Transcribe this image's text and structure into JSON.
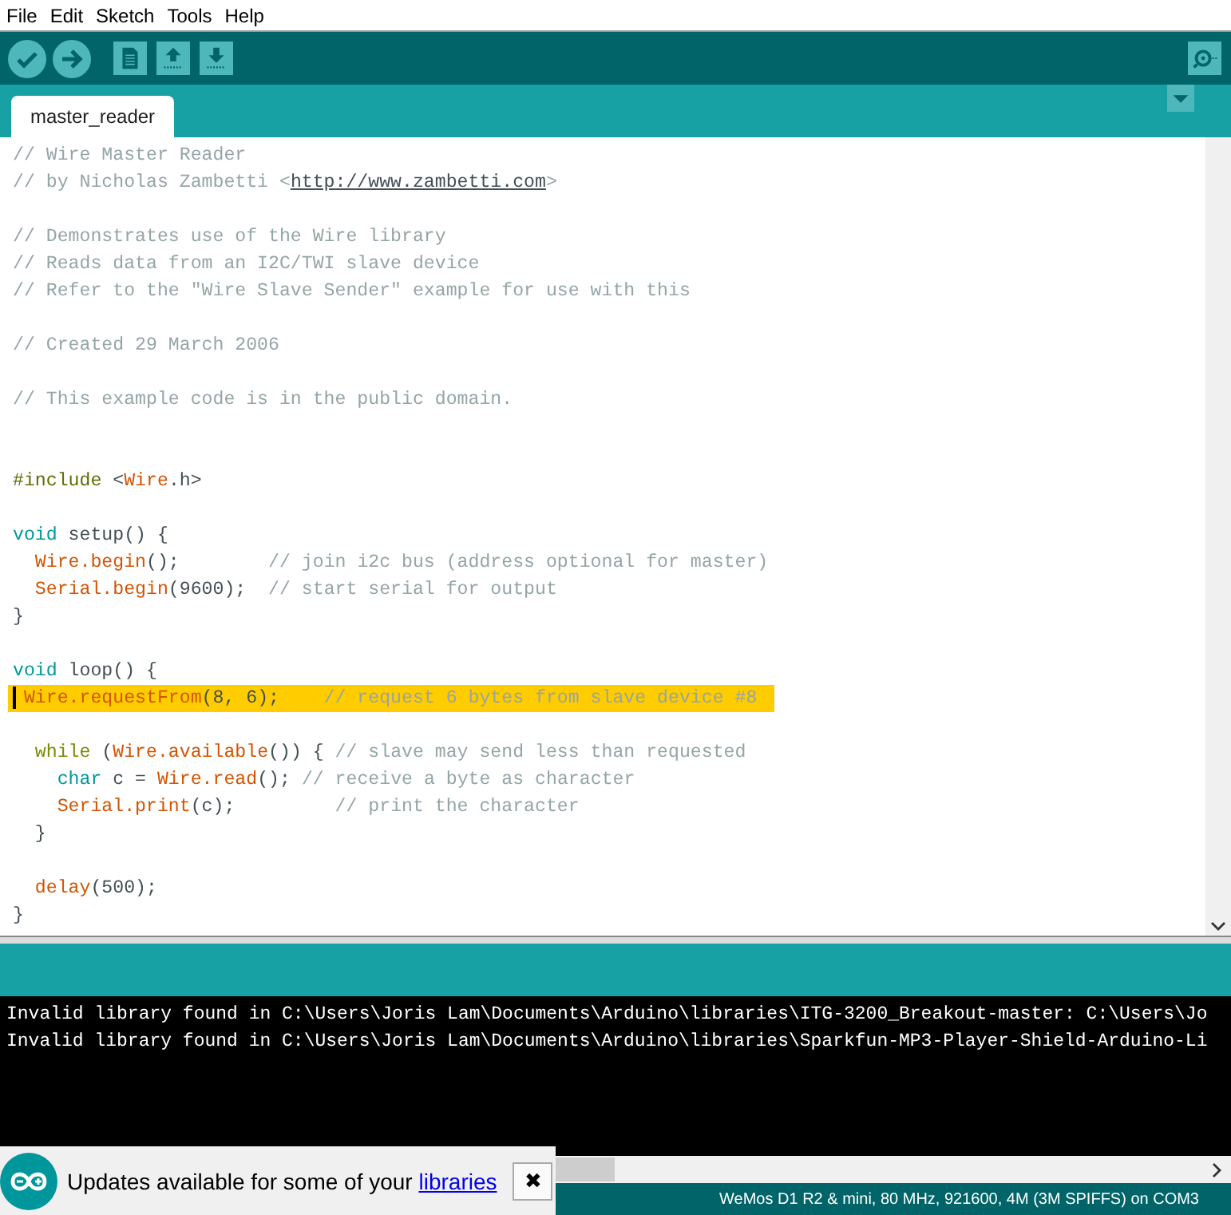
{
  "menu": [
    "File",
    "Edit",
    "Sketch",
    "Tools",
    "Help"
  ],
  "tabs": [
    {
      "label": "master_reader",
      "selected": true
    }
  ],
  "code": [
    {
      "kind": "code",
      "tokens": [
        {
          "t": "// Wire Master Reader",
          "kind": "comment"
        }
      ]
    },
    {
      "kind": "code",
      "tokens": [
        {
          "t": "// by Nicholas Zambetti <",
          "kind": "comment"
        },
        {
          "t": "http://www.zambetti.com",
          "kind": "link"
        },
        {
          "t": ">",
          "kind": "comment"
        }
      ]
    },
    {
      "kind": "blank"
    },
    {
      "kind": "code",
      "tokens": [
        {
          "t": "// Demonstrates use of the Wire library",
          "kind": "comment"
        }
      ]
    },
    {
      "kind": "code",
      "tokens": [
        {
          "t": "// Reads data from an I2C/TWI slave device",
          "kind": "comment"
        }
      ]
    },
    {
      "kind": "code",
      "tokens": [
        {
          "t": "// Refer to the \"Wire Slave Sender\" example for use with this",
          "kind": "comment"
        }
      ]
    },
    {
      "kind": "blank"
    },
    {
      "kind": "code",
      "tokens": [
        {
          "t": "// Created 29 March 2006",
          "kind": "comment"
        }
      ]
    },
    {
      "kind": "blank"
    },
    {
      "kind": "code",
      "tokens": [
        {
          "t": "// This example code is in the public domain.",
          "kind": "comment"
        }
      ]
    },
    {
      "kind": "blank"
    },
    {
      "kind": "blank"
    },
    {
      "kind": "code",
      "tokens": [
        {
          "t": "#include",
          "kind": "preproc"
        },
        {
          "t": " <",
          "kind": "plain"
        },
        {
          "t": "Wire",
          "kind": "func"
        },
        {
          "t": ".h>",
          "kind": "plain"
        }
      ]
    },
    {
      "kind": "blank"
    },
    {
      "kind": "code",
      "tokens": [
        {
          "t": "void",
          "kind": "type"
        },
        {
          "t": " setup() {",
          "kind": "plain"
        }
      ]
    },
    {
      "kind": "code",
      "tokens": [
        {
          "t": "  Wire.begin",
          "kind": "func"
        },
        {
          "t": "();        ",
          "kind": "plain"
        },
        {
          "t": "// join i2c bus (address optional for master)",
          "kind": "comment"
        }
      ]
    },
    {
      "kind": "code",
      "tokens": [
        {
          "t": "  Serial.begin",
          "kind": "func"
        },
        {
          "t": "(9600);  ",
          "kind": "plain"
        },
        {
          "t": "// start serial for output",
          "kind": "comment"
        }
      ]
    },
    {
      "kind": "code",
      "tokens": [
        {
          "t": "}",
          "kind": "plain"
        }
      ]
    },
    {
      "kind": "blank"
    },
    {
      "kind": "code",
      "tokens": [
        {
          "t": "void",
          "kind": "type"
        },
        {
          "t": " loop() {",
          "kind": "plain"
        }
      ]
    },
    {
      "kind": "code",
      "highlighted": true,
      "tokens": [
        {
          "t": " Wire.requestFrom",
          "kind": "func"
        },
        {
          "t": "(8, 6);    ",
          "kind": "plain"
        },
        {
          "t": "// request 6 bytes from slave device #8",
          "kind": "comment"
        }
      ]
    },
    {
      "kind": "blank"
    },
    {
      "kind": "code",
      "tokens": [
        {
          "t": "  while",
          "kind": "keyword"
        },
        {
          "t": " (",
          "kind": "plain"
        },
        {
          "t": "Wire.available",
          "kind": "func"
        },
        {
          "t": "()) { ",
          "kind": "plain"
        },
        {
          "t": "// slave may send less than requested",
          "kind": "comment"
        }
      ]
    },
    {
      "kind": "code",
      "tokens": [
        {
          "t": "    char",
          "kind": "type"
        },
        {
          "t": " c = ",
          "kind": "plain"
        },
        {
          "t": "Wire.read",
          "kind": "func"
        },
        {
          "t": "(); ",
          "kind": "plain"
        },
        {
          "t": "// receive a byte as character",
          "kind": "comment"
        }
      ]
    },
    {
      "kind": "code",
      "tokens": [
        {
          "t": "    Serial.print",
          "kind": "func"
        },
        {
          "t": "(c);         ",
          "kind": "plain"
        },
        {
          "t": "// print the character",
          "kind": "comment"
        }
      ]
    },
    {
      "kind": "code",
      "tokens": [
        {
          "t": "  }",
          "kind": "plain"
        }
      ]
    },
    {
      "kind": "blank"
    },
    {
      "kind": "code",
      "tokens": [
        {
          "t": "  delay",
          "kind": "func"
        },
        {
          "t": "(500);",
          "kind": "plain"
        }
      ]
    },
    {
      "kind": "code",
      "tokens": [
        {
          "t": "}",
          "kind": "plain"
        }
      ]
    }
  ],
  "console": [
    "Invalid library found in C:\\Users\\Joris Lam\\Documents\\Arduino\\libraries\\ITG-3200_Breakout-master: C:\\Users\\Jo",
    "Invalid library found in C:\\Users\\Joris Lam\\Documents\\Arduino\\libraries\\Sparkfun-MP3-Player-Shield-Arduino-Li"
  ],
  "notification": {
    "text": "Updates available for some of your ",
    "link": "libraries",
    "close": "✖"
  },
  "status_bar": "WeMos D1 R2 & mini, 80 MHz, 921600, 4M (3M SPIFFS) on COM3"
}
